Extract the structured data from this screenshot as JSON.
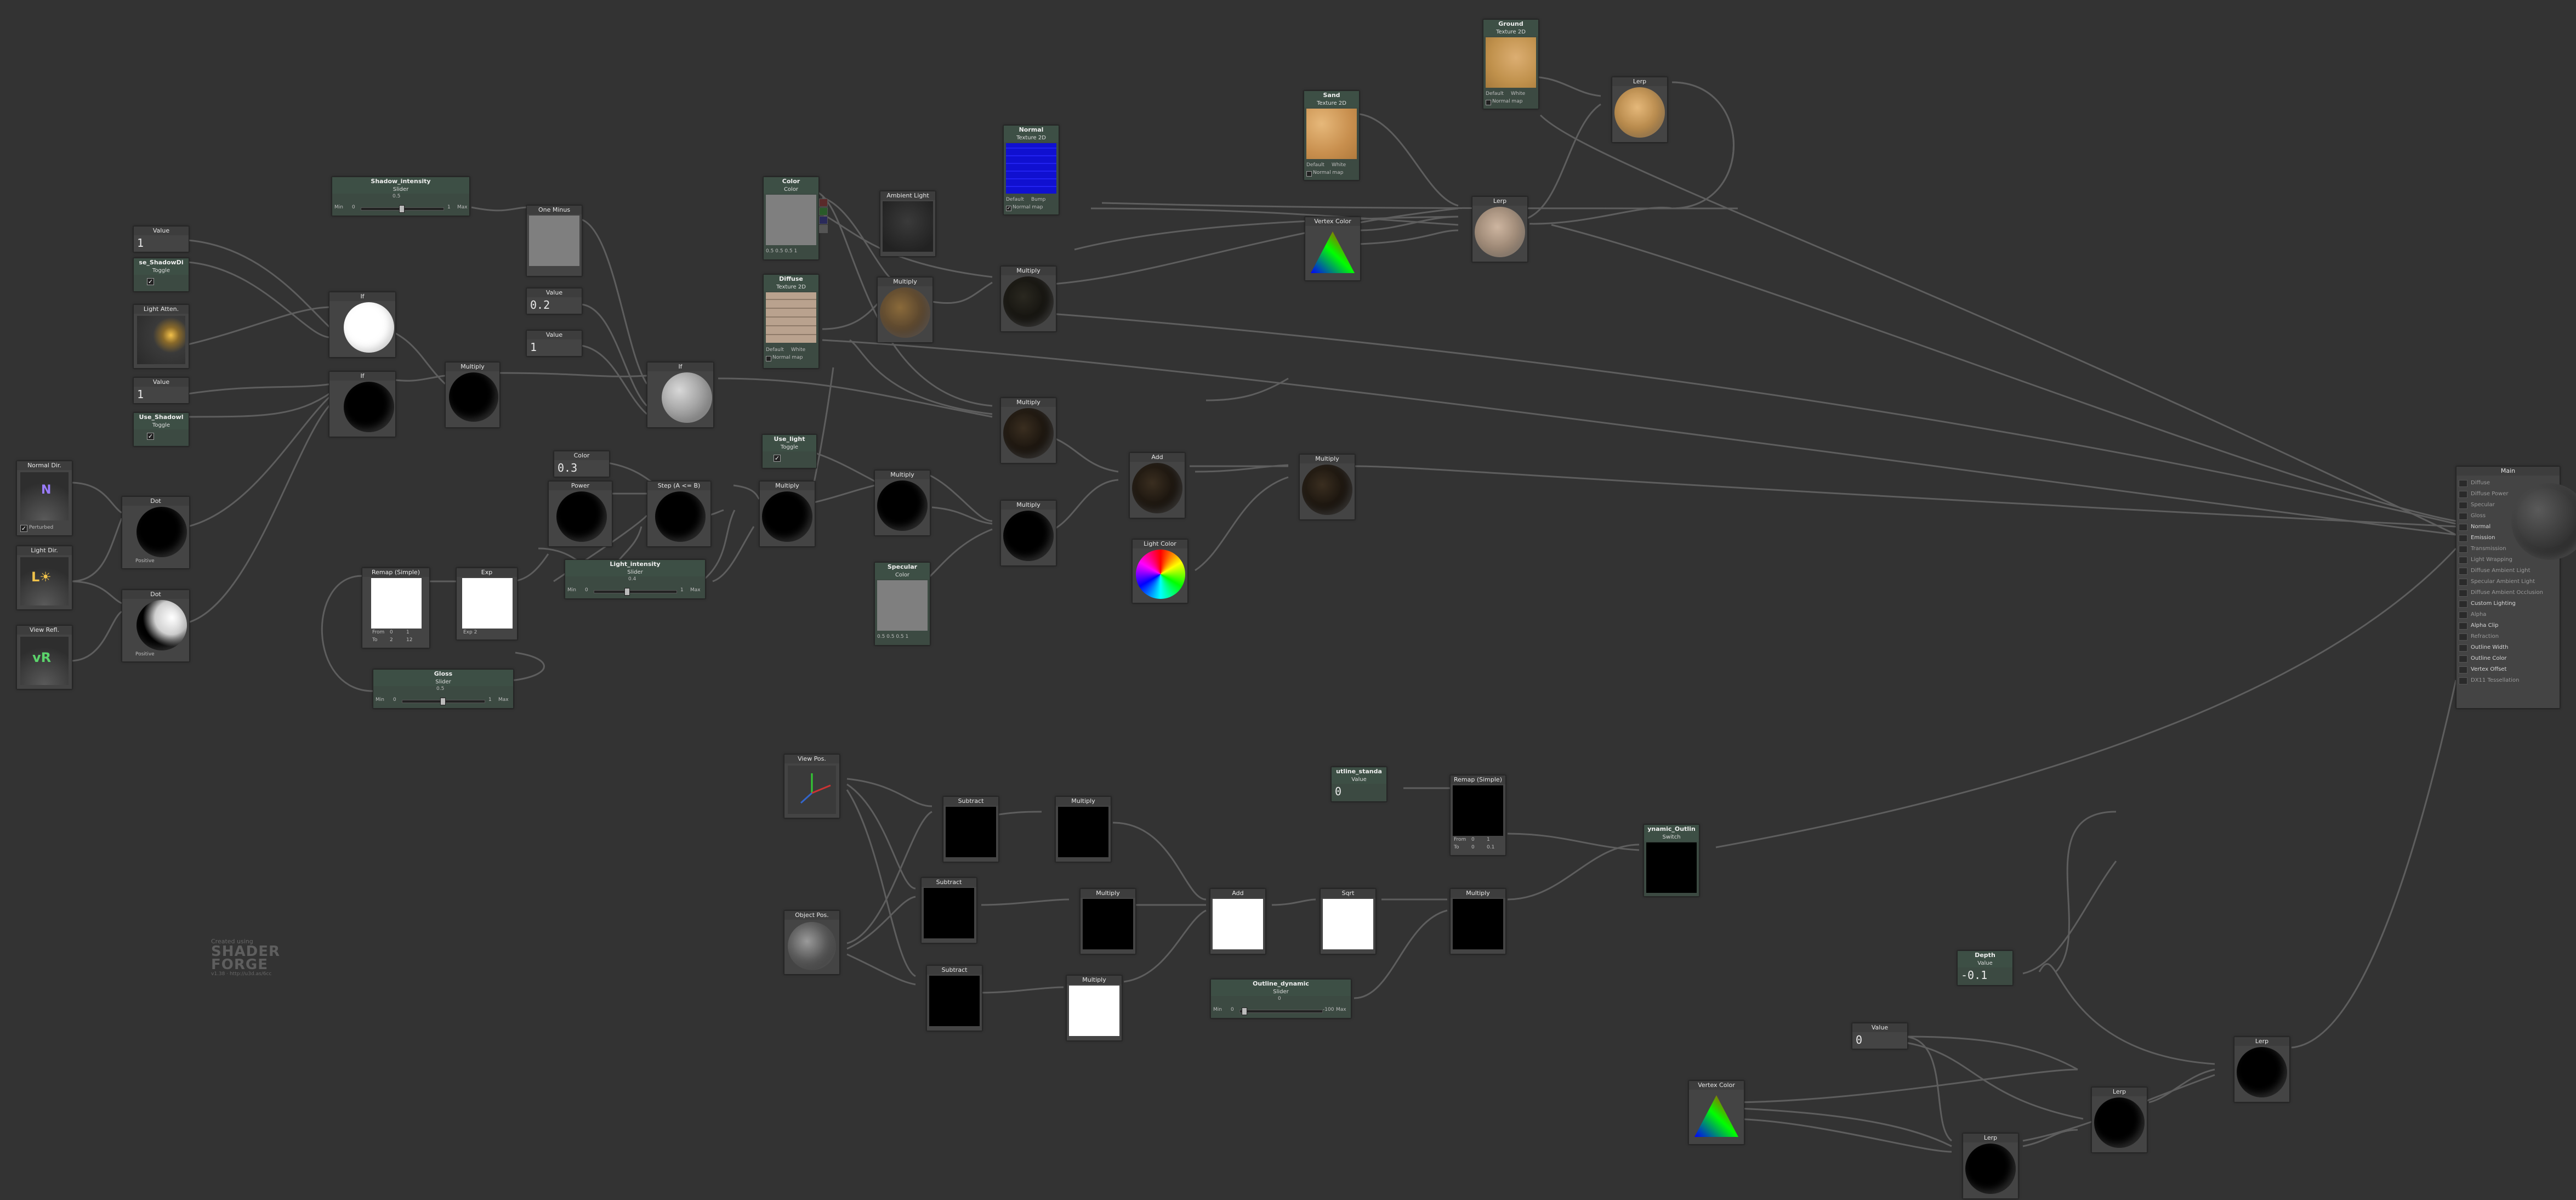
{
  "nodes": {
    "shadow_intensity": {
      "title": "Shadow_intensity",
      "sub": "Slider",
      "value": "0.5",
      "min_label": "Min",
      "min": "0",
      "max": "1",
      "max_label": "Max"
    },
    "color_1": {
      "title": "Value",
      "value": "1"
    },
    "use_shadowdir": {
      "title": "se_ShadowDi",
      "sub": "Toggle",
      "check": "✓"
    },
    "light_atten": {
      "title": "Light Atten."
    },
    "value_1b": {
      "title": "Value",
      "value": "1"
    },
    "use_shadowlevel": {
      "title": "Use_Shadowl",
      "sub": "Toggle",
      "check": "✓"
    },
    "normal_dir": {
      "title": "Normal Dir.",
      "perturbed": "Perturbed"
    },
    "light_dir": {
      "title": "Light Dir."
    },
    "view_refl": {
      "title": "View Refl."
    },
    "if_1": {
      "title": "If"
    },
    "if_2": {
      "title": "If"
    },
    "multiply_1": {
      "title": "Multiply"
    },
    "one_minus": {
      "title": "One Minus"
    },
    "value_02": {
      "title": "Value",
      "value": "0.2"
    },
    "value_1c": {
      "title": "Value",
      "value": "1"
    },
    "if_3": {
      "title": "If"
    },
    "dot_1": {
      "title": "Dot",
      "mode": "Positive"
    },
    "dot_2": {
      "title": "Dot",
      "mode": "Positive"
    },
    "color_03": {
      "title": "Color",
      "value": "0.3"
    },
    "power": {
      "title": "Power"
    },
    "step": {
      "title": "Step (A <= B)"
    },
    "light_intensity": {
      "title": "Light_intensity",
      "sub": "Slider",
      "value": "0.4",
      "min_label": "Min",
      "min": "0",
      "max": "1",
      "max_label": "Max"
    },
    "remap": {
      "title": "Remap (Simple)",
      "from_label": "From",
      "from_a": "0",
      "from_b": "1",
      "to_label": "To",
      "to_a": "2",
      "to_b": "12"
    },
    "exp": {
      "title": "Exp",
      "mode": "Exp 2"
    },
    "gloss": {
      "title": "Gloss",
      "sub": "Slider",
      "value": "0.5",
      "min_label": "Min",
      "min": "0",
      "max": "1",
      "max_label": "Max"
    },
    "color_main": {
      "title": "Color",
      "sub": "Color",
      "values": "0.5  0.5  0.5  1"
    },
    "ambient_light": {
      "title": "Ambient Light"
    },
    "diffuse": {
      "title": "Diffuse",
      "sub": "Texture 2D",
      "default": "Default",
      "default_val": "White",
      "normal_map": "Normal map"
    },
    "multiply_2": {
      "title": "Multiply"
    },
    "multiply_3": {
      "title": "Multiply"
    },
    "normal_tex": {
      "title": "Normal",
      "sub": "Texture 2D",
      "default": "Default",
      "default_val": "Bump",
      "normal_map": "Normal map"
    },
    "use_light": {
      "title": "Use_light",
      "sub": "Toggle",
      "check": "✓"
    },
    "multiply_4": {
      "title": "Multiply"
    },
    "multiply_5": {
      "title": "Multiply"
    },
    "multiply_6": {
      "title": "Multiply"
    },
    "multiply_7": {
      "title": "Multiply"
    },
    "specular": {
      "title": "Specular",
      "sub": "Color",
      "values": "0.5  0.5  0.5  1"
    },
    "add_1": {
      "title": "Add"
    },
    "multiply_8": {
      "title": "Multiply"
    },
    "light_color": {
      "title": "Light Color"
    },
    "sand": {
      "title": "Sand",
      "sub": "Texture 2D",
      "default": "Default",
      "default_val": "White",
      "normal_map": "Normal map"
    },
    "ground": {
      "title": "Ground",
      "sub": "Texture 2D",
      "default": "Default",
      "default_val": "White",
      "normal_map": "Normal map"
    },
    "vertex_color_1": {
      "title": "Vertex Color"
    },
    "lerp_1": {
      "title": "Lerp"
    },
    "lerp_2": {
      "title": "Lerp"
    },
    "main": {
      "title": "Main",
      "inputs": [
        "Diffuse",
        "Diffuse Power",
        "Specular",
        "Gloss",
        "Normal",
        "Emission",
        "Transmission",
        "Light Wrapping",
        "Diffuse Ambient Light",
        "Specular Ambient Light",
        "Diffuse Ambient Occlusion",
        "Custom Lighting",
        "Alpha",
        "Alpha Clip",
        "Refraction",
        "Outline Width",
        "Outline Color",
        "Vertex Offset",
        "DX11 Tessellation"
      ],
      "active": [
        "Normal",
        "Emission",
        "Custom Lighting",
        "Alpha Clip",
        "Outline Width",
        "Outline Color",
        "Vertex Offset"
      ]
    },
    "view_pos": {
      "title": "View Pos."
    },
    "object_pos": {
      "title": "Object Pos."
    },
    "subtract_1": {
      "title": "Subtract"
    },
    "subtract_2": {
      "title": "Subtract"
    },
    "subtract_3": {
      "title": "Subtract"
    },
    "multiply_9": {
      "title": "Multiply"
    },
    "multiply_10": {
      "title": "Multiply"
    },
    "multiply_11": {
      "title": "Multiply"
    },
    "add_2": {
      "title": "Add"
    },
    "sqrt": {
      "title": "Sqrt"
    },
    "multiply_12": {
      "title": "Multiply"
    },
    "outline_dynamic": {
      "title": "Outline_dynamic",
      "sub": "Slider",
      "value": "0",
      "min_label": "Min",
      "min": "0",
      "max": "-100",
      "max_label": "Max"
    },
    "outline_standard": {
      "title": "utline_standa",
      "sub": "Value",
      "value": "0"
    },
    "remap_2": {
      "title": "Remap (Simple)",
      "from_label": "From",
      "from_a": "0",
      "from_b": "1",
      "to_label": "To",
      "to_a": "0",
      "to_b": "0.1"
    },
    "dynamic_outline": {
      "title": "ynamic_Outlin",
      "sub": "Switch"
    },
    "depth": {
      "title": "Depth",
      "sub": "Value",
      "value": "-0.1"
    },
    "value_0": {
      "title": "Value",
      "value": "0"
    },
    "vertex_color_2": {
      "title": "Vertex Color"
    },
    "lerp_3": {
      "title": "Lerp"
    },
    "lerp_4": {
      "title": "Lerp"
    },
    "lerp_5": {
      "title": "Lerp"
    }
  },
  "credit": {
    "line1": "Created using",
    "logo1": "SHADER",
    "logo2": "FORGE",
    "line2": "v1.38 · http://u3d.as/6cc"
  },
  "colors": {
    "background": "#333333",
    "property_header": "#3d4f45",
    "wire": "#6a6a6a"
  }
}
